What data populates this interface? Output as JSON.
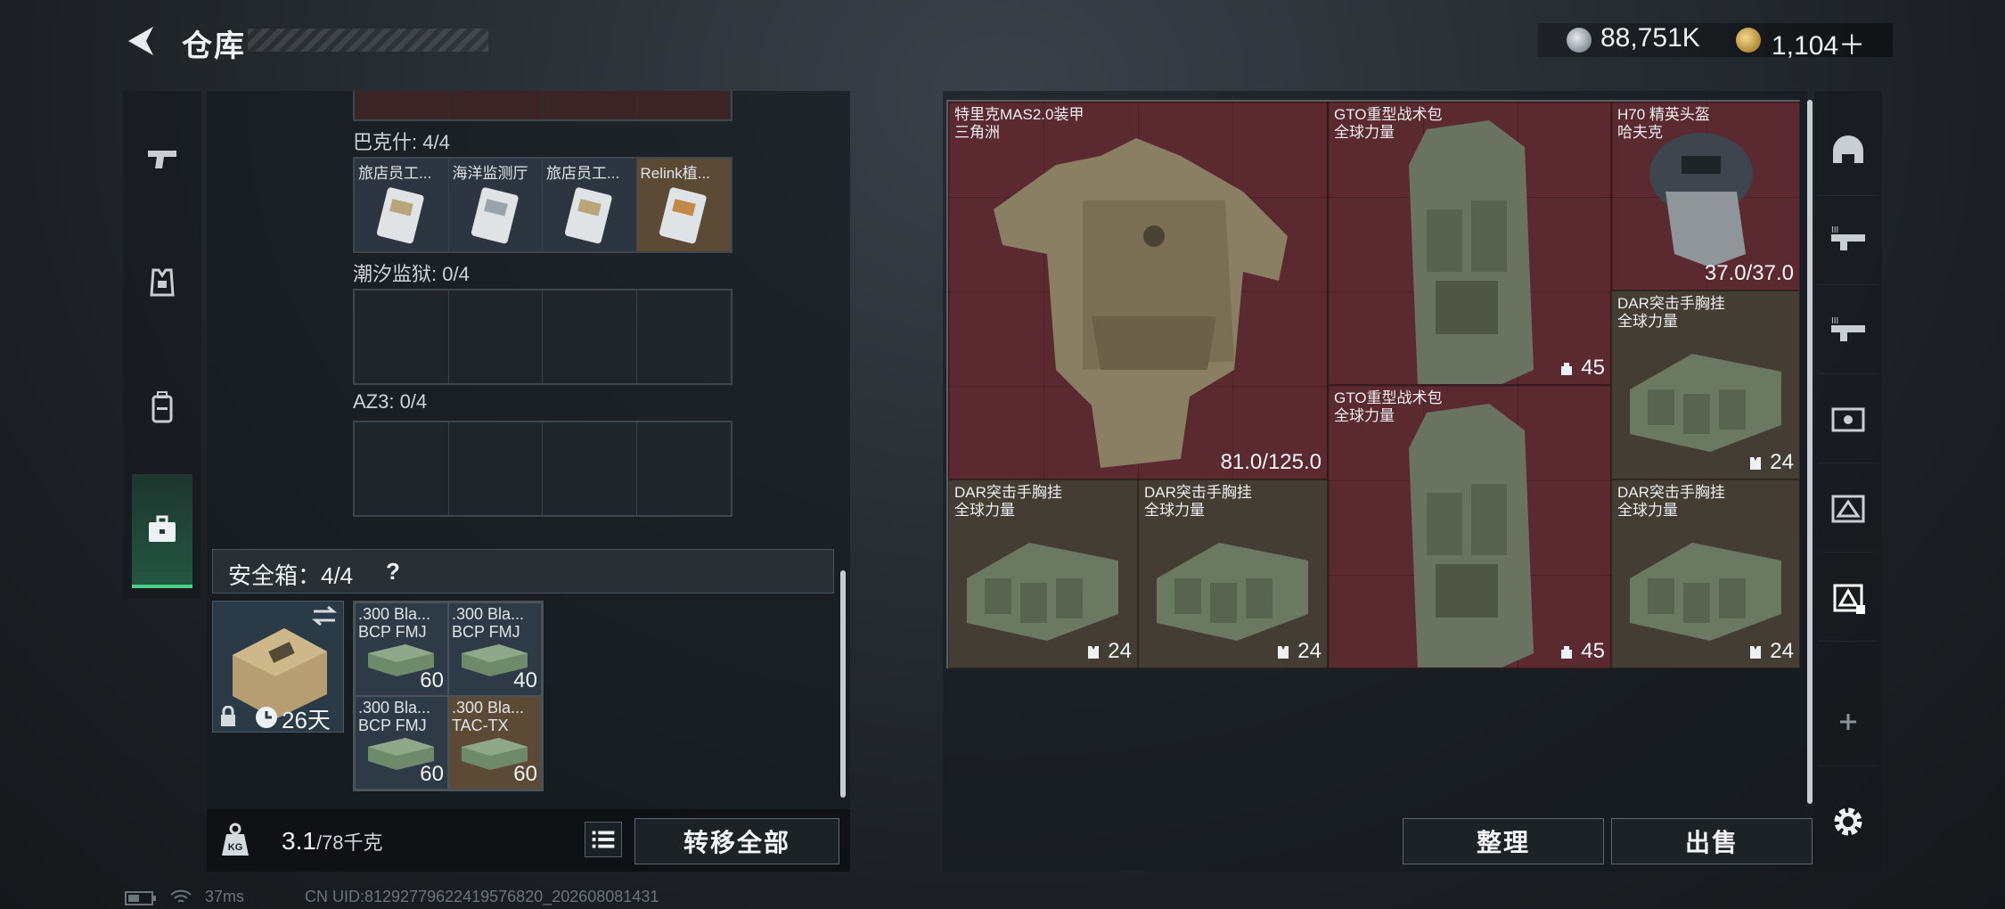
{
  "header": {
    "title": "仓库"
  },
  "currency": {
    "silver": "88,751K",
    "gold": "1,104＋"
  },
  "stash": {
    "sections": [
      {
        "label": "巴克什: 4/4",
        "items": [
          "旅店员工...",
          "海洋监测厅",
          "旅店员工...",
          "Relink植..."
        ]
      },
      {
        "label": "潮汐监狱: 0/4"
      },
      {
        "label": "AZ3: 0/4"
      }
    ],
    "safe_label": "安全箱：4/4",
    "safe_days": "26天",
    "ammo": [
      {
        "name": ".300 Bla...",
        "sub": "BCP FMJ",
        "count": "60"
      },
      {
        "name": ".300 Bla...",
        "sub": "BCP FMJ",
        "count": "40"
      },
      {
        "name": ".300 Bla...",
        "sub": "BCP FMJ",
        "count": "60"
      },
      {
        "name": ".300 Bla...",
        "sub": "TAC-TX",
        "count": "60"
      }
    ],
    "weight_value": "3.1",
    "weight_max": "/78千克",
    "transfer_label": "转移全部"
  },
  "loadout": {
    "armor": {
      "name": "特里克MAS2.0装甲",
      "maker": "三角洲",
      "value": "81.0/125.0"
    },
    "backpack1": {
      "name": "GTO重型战术包",
      "maker": "全球力量",
      "value": "45"
    },
    "helmet": {
      "name": "H70 精英头盔",
      "maker": "哈夫克",
      "value": "37.0/37.0"
    },
    "rig_top": {
      "name": "DAR突击手胸挂",
      "maker": "全球力量",
      "value": "24"
    },
    "backpack2": {
      "name": "GTO重型战术包",
      "maker": "全球力量",
      "value": "45"
    },
    "rig1": {
      "name": "DAR突击手胸挂",
      "maker": "全球力量",
      "value": "24"
    },
    "rig2": {
      "name": "DAR突击手胸挂",
      "maker": "全球力量",
      "value": "24"
    },
    "rig3": {
      "name": "DAR突击手胸挂",
      "maker": "全球力量",
      "value": "24"
    }
  },
  "actions": {
    "sort": "整理",
    "sell": "出售"
  },
  "status": {
    "ping": "37ms",
    "uid": "CN UID:81292779622419576820_202608081431"
  },
  "colors": {
    "accent": "#49d18a",
    "slot_red": "#5a2a30",
    "slot_olive": "#443d33"
  }
}
